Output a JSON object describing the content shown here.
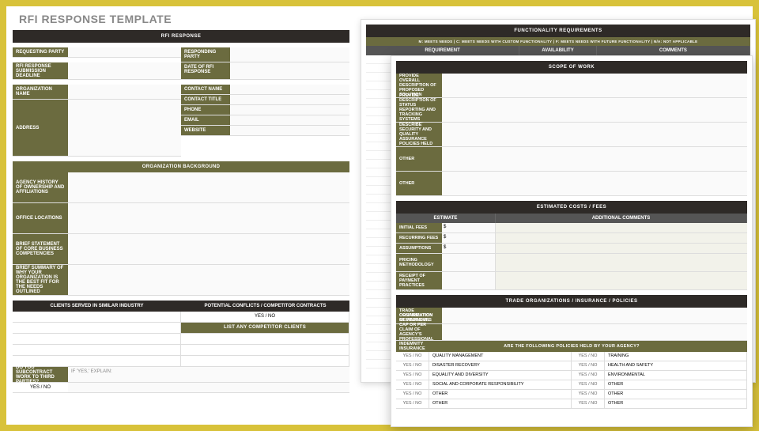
{
  "title": "RFI RESPONSE TEMPLATE",
  "page1": {
    "header": "RFI RESPONSE",
    "fields": {
      "requesting_party": "REQUESTING PARTY",
      "responding_party": "RESPONDING PARTY",
      "deadline": "RFI RESPONSE SUBMISSION DEADLINE",
      "date": "DATE OF RFI RESPONSE",
      "org_name": "ORGANIZATION NAME",
      "contact_name": "CONTACT NAME",
      "contact_title": "CONTACT TITLE",
      "phone": "PHONE",
      "email": "EMAIL",
      "website": "WEBSITE",
      "address": "ADDRESS"
    },
    "org_bg_header": "ORGANIZATION BACKGROUND",
    "bg": {
      "history": "AGENCY HISTORY OF OWNERSHIP AND AFFILIATIONS",
      "locations": "OFFICE LOCATIONS",
      "competencies": "BRIEF STATEMENT OF CORE BUSINESS COMPETENCIES",
      "summary": "BRIEF SUMMARY OF WHY YOUR ORGANIZATION IS THE BEST FIT FOR THE NEEDS OUTLINED"
    },
    "clients_header": "CLIENTS SERVED IN SIMILAR INDUSTRY",
    "conflicts_header": "POTENTIAL CONFLICTS / COMPETITOR CONTRACTS",
    "yesno_cell": "YES  /  NO",
    "list_comp": "LIST ANY COMPETITOR CLIENTS",
    "subcontract_q": "DO YOU SUBCONTRACT WORK TO THIRD PARTIES?",
    "if_explain": "IF 'YES,' EXPLAIN:"
  },
  "page2": {
    "header": "FUNCTIONALITY REQUIREMENTS",
    "legend": "M: MEETS NEEDS   |   C: MEETS NEEDS WITH CUSTOM FUNCTIONALITY   |   F: MEETS NEEDS WITH FUTURE FUNCTIONALITY   |   N/A: NOT APPLICABLE",
    "cols": {
      "a": "REQUIREMENT",
      "b": "AVAILABILITY",
      "c": "COMMENTS"
    }
  },
  "page3": {
    "scope_header": "SCOPE OF WORK",
    "scope_rows": [
      "PROVIDE OVERALL DESCRIPTION OF PROPOSED SOLUTION",
      "PROVIDE DESCRIPTION OF STATUS REPORTING AND TRACKING SYSTEMS EMPLOYED",
      "DESCRIBE SECURITY AND QUALITY ASSURANCE POLICIES HELD",
      "OTHER",
      "OTHER"
    ],
    "est_header": "ESTIMATED COSTS / FEES",
    "est_cols": {
      "a": "ESTIMATE",
      "b": "ADDITIONAL COMMENTS"
    },
    "est_rows": [
      {
        "lbl": "INITIAL FEES",
        "v": "$"
      },
      {
        "lbl": "RECURRING FEES",
        "v": "$"
      },
      {
        "lbl": "ASSUMPTIONS",
        "v": "$"
      },
      {
        "lbl": "PRICING METHODOLOGY",
        "v": ""
      },
      {
        "lbl": "RECEIPT OF PAYMENT PRACTICES",
        "v": ""
      }
    ],
    "trade_header": "TRADE ORGANIZATIONS / INSURANCE / POLICIES",
    "trade_rows": [
      "TRADE ORGANIZATION MEMBERSHIPS",
      "CONFIRMATION OF FINANCIAL CAP OR PER CLAIM OF AGENCY'S PROFESSIONAL INDEMNITY INSURANCE"
    ],
    "policies_header": "ARE THE FOLLOWING POLICIES HELD BY YOUR AGENCY?",
    "yesno": "YES  /  NO",
    "policies": [
      [
        "QUALITY MANAGEMENT",
        "TRAINING"
      ],
      [
        "DISASTER RECOVERY",
        "HEALTH AND SAFETY"
      ],
      [
        "EQUALITY AND DIVERSITY",
        "ENVIRONMENTAL"
      ],
      [
        "SOCIAL AND CORPORATE RESPONSIBILITY",
        "OTHER"
      ],
      [
        "OTHER",
        "OTHER"
      ],
      [
        "OTHER",
        "OTHER"
      ]
    ]
  }
}
